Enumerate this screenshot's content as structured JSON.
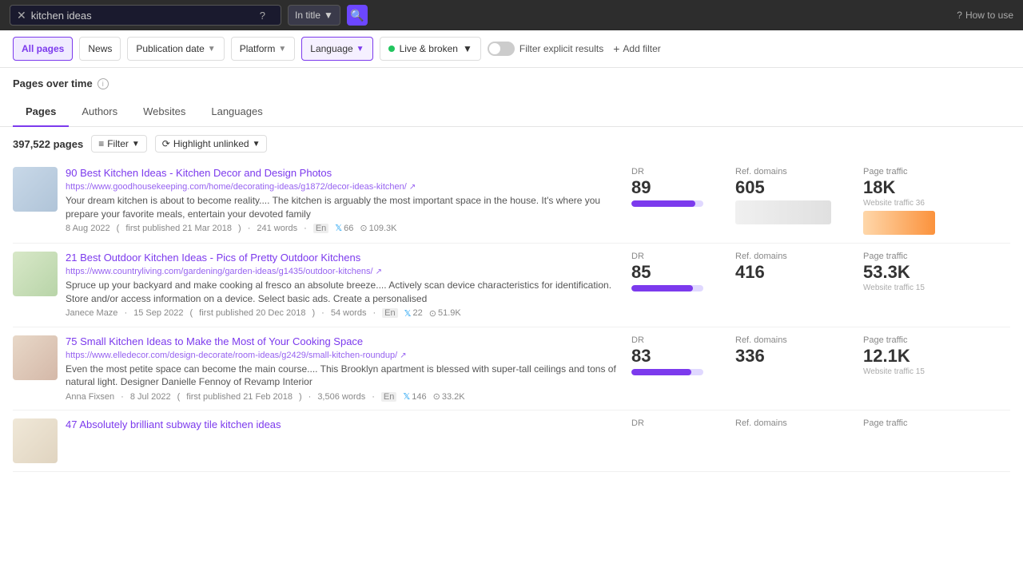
{
  "searchBar": {
    "query": "kitchen ideas",
    "searchMode": "In title",
    "howToUse": "How to use"
  },
  "filters": {
    "allPages": "All pages",
    "news": "News",
    "publicationDate": "Publication date",
    "platform": "Platform",
    "language": "Language",
    "liveBroken": "Live & broken",
    "filterExplicit": "Filter explicit results",
    "addFilter": "Add filter"
  },
  "pagesOverTime": {
    "label": "Pages over time"
  },
  "tabs": [
    {
      "label": "Pages",
      "active": true
    },
    {
      "label": "Authors",
      "active": false
    },
    {
      "label": "Websites",
      "active": false
    },
    {
      "label": "Languages",
      "active": false
    }
  ],
  "results": {
    "count": "397,522 pages",
    "filterLabel": "Filter",
    "highlightLabel": "Highlight unlinked",
    "columns": {
      "dr": "DR",
      "refDomains": "Ref. domains",
      "pageTraffic": "Page traffic"
    },
    "items": [
      {
        "title": "90 Best Kitchen Ideas - Kitchen Decor and Design Photos",
        "url": "https://www.goodhousekeeping.com/home/decorating-ideas/g1872/decor-ideas-kitchen/",
        "excerpt": "Your dream kitchen is about to become reality.... The kitchen is arguably the most important space in the house. It's where you prepare your favorite meals, entertain your devoted family",
        "date": "8 Aug 2022",
        "firstPublished": "first published 21 Mar 2018",
        "wordCount": "241 words",
        "lang": "En",
        "twitterShares": "66",
        "backlinks": "109.3K",
        "dr": "89",
        "drBarPercent": 89,
        "refDomains": "605",
        "pageTraffic": "18K",
        "websiteTraffic": "Website traffic 36"
      },
      {
        "title": "21 Best Outdoor Kitchen Ideas - Pics of Pretty Outdoor Kitchens",
        "url": "https://www.countryliving.com/gardening/garden-ideas/g1435/outdoor-kitchens/",
        "excerpt": "Spruce up your backyard and make cooking al fresco an absolute breeze.... Actively scan device characteristics for identification. Store and/or access information on a device. Select basic ads. Create a personalised",
        "author": "Janece Maze",
        "date": "15 Sep 2022",
        "firstPublished": "first published 20 Dec 2018",
        "wordCount": "54 words",
        "lang": "En",
        "twitterShares": "22",
        "backlinks": "51.9K",
        "dr": "85",
        "drBarPercent": 85,
        "refDomains": "416",
        "pageTraffic": "53.3K",
        "websiteTraffic": "Website traffic 15"
      },
      {
        "title": "75 Small Kitchen Ideas to Make the Most of Your Cooking Space",
        "url": "https://www.elledecor.com/design-decorate/room-ideas/g2429/small-kitchen-roundup/",
        "excerpt": "Even the most petite space can become the main course.... This Brooklyn apartment is blessed with super-tall ceilings and tons of natural light. Designer Danielle Fennoy of Revamp Interior",
        "author": "Anna Fixsen",
        "date": "8 Jul 2022",
        "firstPublished": "first published 21 Feb 2018",
        "wordCount": "3,506 words",
        "lang": "En",
        "twitterShares": "146",
        "backlinks": "33.2K",
        "dr": "83",
        "drBarPercent": 83,
        "refDomains": "336",
        "pageTraffic": "12.1K",
        "websiteTraffic": "Website traffic 15"
      },
      {
        "title": "47 Absolutely brilliant subway tile kitchen ideas",
        "url": "",
        "excerpt": "",
        "author": "",
        "date": "",
        "firstPublished": "",
        "wordCount": "",
        "lang": "",
        "twitterShares": "",
        "backlinks": "",
        "dr": "",
        "drBarPercent": 0,
        "refDomains": "",
        "pageTraffic": "",
        "websiteTraffic": ""
      }
    ]
  }
}
